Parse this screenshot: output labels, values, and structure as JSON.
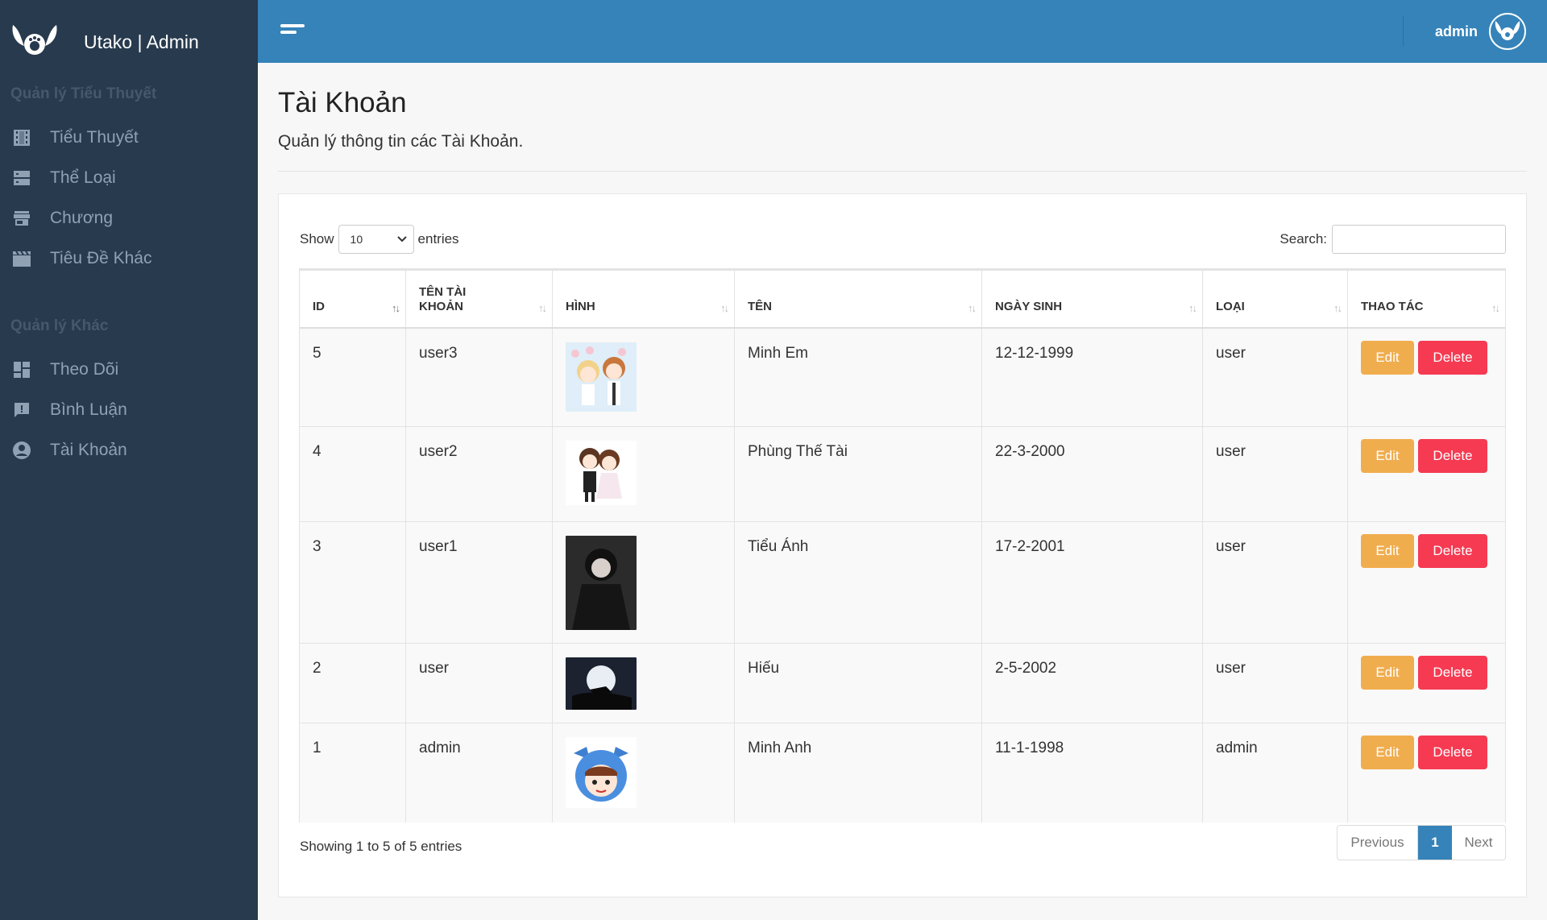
{
  "brand": {
    "title": "Utako | Admin"
  },
  "sidebar": {
    "section1": "Quản lý Tiểu Thuyết",
    "section2": "Quản lý Khác",
    "items": [
      {
        "label": "Tiểu Thuyết",
        "icon": "film-icon"
      },
      {
        "label": "Thể Loại",
        "icon": "server-icon"
      },
      {
        "label": "Chương",
        "icon": "store-icon"
      },
      {
        "label": "Tiêu Đề Khác",
        "icon": "clapperboard-icon"
      },
      {
        "label": "Theo Dõi",
        "icon": "dashboard-icon"
      },
      {
        "label": "Bình Luận",
        "icon": "feedback-icon"
      },
      {
        "label": "Tài Khoản",
        "icon": "account-circle-icon"
      }
    ]
  },
  "topbar": {
    "username": "admin"
  },
  "page": {
    "title": "Tài Khoản",
    "subtitle": "Quản lý thông tin các Tài Khoản."
  },
  "controls": {
    "show_label": "Show",
    "entries_value": "10",
    "entries_label": "entries",
    "search_label": "Search:"
  },
  "table": {
    "headers": [
      "ID",
      "TÊN TÀI KHOẢN",
      "HÌNH",
      "TÊN",
      "NGÀY SINH",
      "LOẠI",
      "THAO TÁC"
    ],
    "edit_label": "Edit",
    "delete_label": "Delete",
    "rows": [
      {
        "id": "5",
        "username": "user3",
        "name": "Minh Em",
        "dob": "12-12-1999",
        "type": "user"
      },
      {
        "id": "4",
        "username": "user2",
        "name": "Phùng Thế Tài",
        "dob": "22-3-2000",
        "type": "user"
      },
      {
        "id": "3",
        "username": "user1",
        "name": "Tiểu Ánh",
        "dob": "17-2-2001",
        "type": "user"
      },
      {
        "id": "2",
        "username": "user",
        "name": "Hiếu",
        "dob": "2-5-2002",
        "type": "user"
      },
      {
        "id": "1",
        "username": "admin",
        "name": "Minh Anh",
        "dob": "11-1-1998",
        "type": "admin"
      }
    ]
  },
  "footer": {
    "info": "Showing 1 to 5 of 5 entries",
    "prev": "Previous",
    "page": "1",
    "next": "Next"
  },
  "colors": {
    "sidebar": "#283a4e",
    "topbar": "#3583b9",
    "edit": "#f0ad4e",
    "delete": "#f53a52"
  }
}
